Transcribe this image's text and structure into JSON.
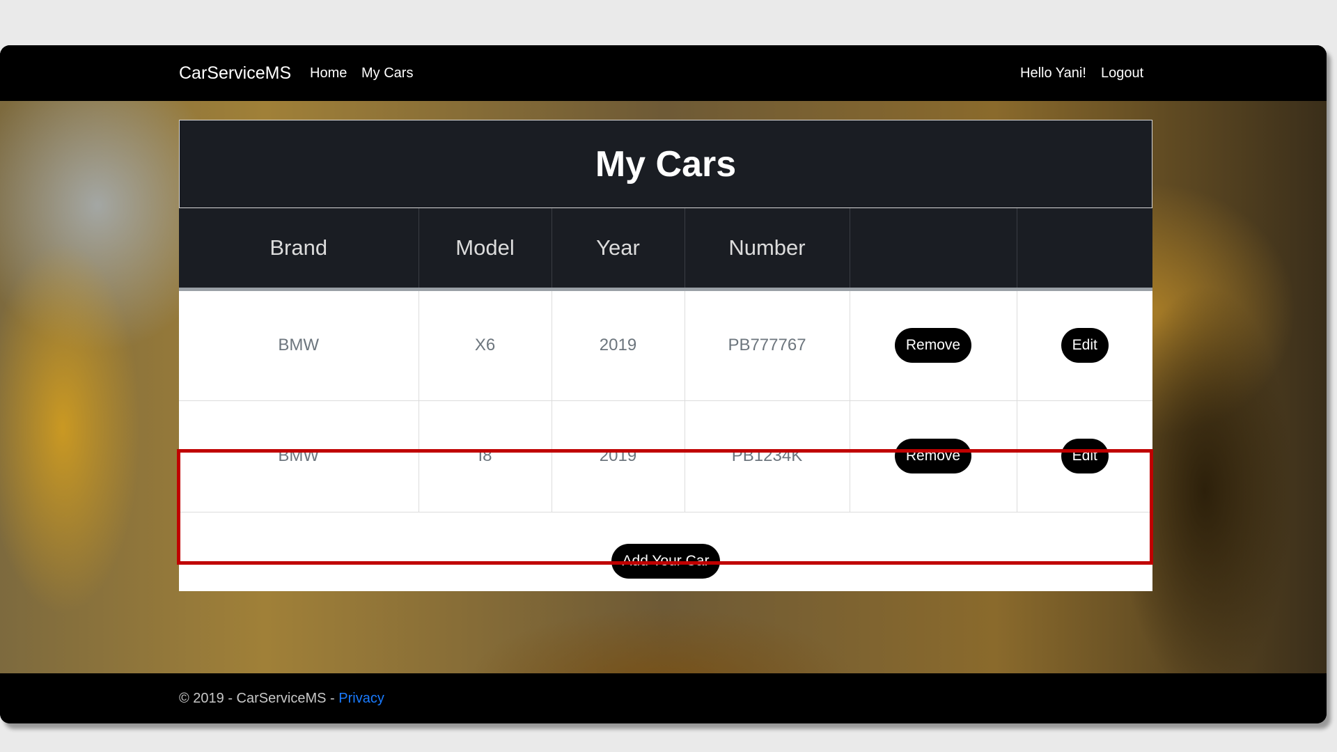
{
  "navbar": {
    "brand": "CarServiceMS",
    "links": [
      "Home",
      "My Cars"
    ],
    "greeting": "Hello Yani!",
    "logout": "Logout"
  },
  "page": {
    "title": "My Cars"
  },
  "table": {
    "headers": [
      "Brand",
      "Model",
      "Year",
      "Number",
      "",
      ""
    ],
    "rows": [
      {
        "brand": "BMW",
        "model": "X6",
        "year": "2019",
        "number": "PB777767",
        "remove": "Remove",
        "edit": "Edit"
      },
      {
        "brand": "BMW",
        "model": "I8",
        "year": "2019",
        "number": "PB1234K",
        "remove": "Remove",
        "edit": "Edit"
      }
    ],
    "highlighted_row": 1
  },
  "actions": {
    "add_car": "Add Your Car"
  },
  "footer": {
    "copyright": "© 2019 - CarServiceMS - ",
    "privacy": "Privacy"
  },
  "colors": {
    "navbar": "#000000",
    "table_header": "#1a1d23",
    "button": "#000000",
    "highlight": "#c00000",
    "link": "#1a7bff"
  }
}
